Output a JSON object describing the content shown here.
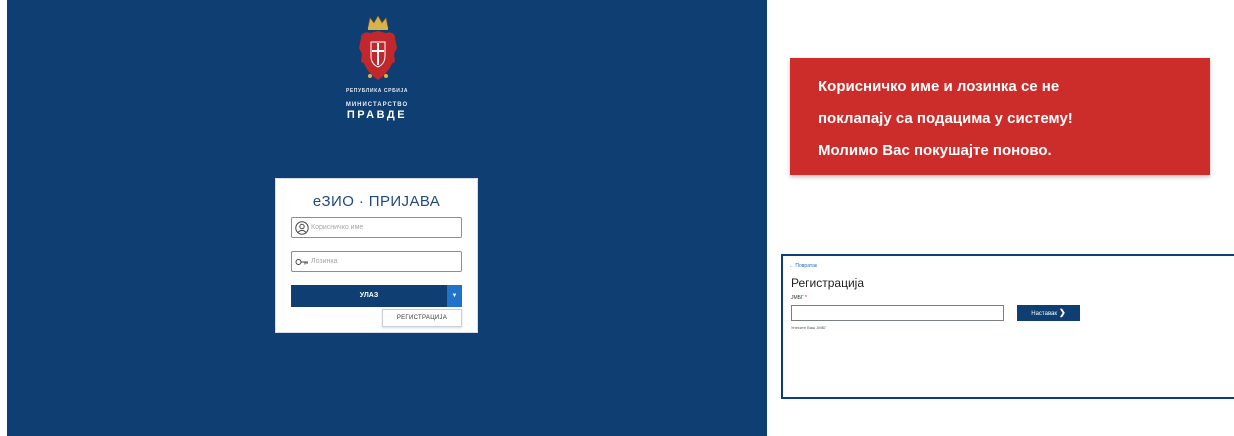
{
  "login": {
    "republic_text": "РЕПУБЛИКА СРБИЈА",
    "ministry_line1": "МИНИСТАРСТВО",
    "ministry_line2": "ПРАВДЕ",
    "title": "еЗИО · ПРИЈАВА",
    "username_placeholder": "Корисничко име",
    "password_placeholder": "Лозинка",
    "username_value": "",
    "password_value": "",
    "login_button": "УЛАЗ",
    "dropdown_item": "РЕГИСТРАЦИЈА",
    "icons": {
      "emblem": "serbian-coat-of-arms-icon",
      "user": "user-icon",
      "password": "key-icon",
      "dropdown": "caret-down-icon"
    },
    "colors": {
      "background": "#0f3e72",
      "button": "#0f3e72",
      "dropdown_button": "#1f73c9"
    }
  },
  "error": {
    "line1": "Корисничко име и лозинка се не",
    "line2": "поклапају са подацима у систему!",
    "line3": "Молимо Вас покушајте поново.",
    "color": "#cd2d2a"
  },
  "registration": {
    "back_link": "← Повратак",
    "title": "Регистрација",
    "jmbg_label": "ЈМБГ",
    "required_mark": "*",
    "jmbg_value": "",
    "next_button": "Наставак",
    "hint": "Унесите Ваш ЈМБГ",
    "icons": {
      "next": "chevron-right-icon"
    }
  }
}
